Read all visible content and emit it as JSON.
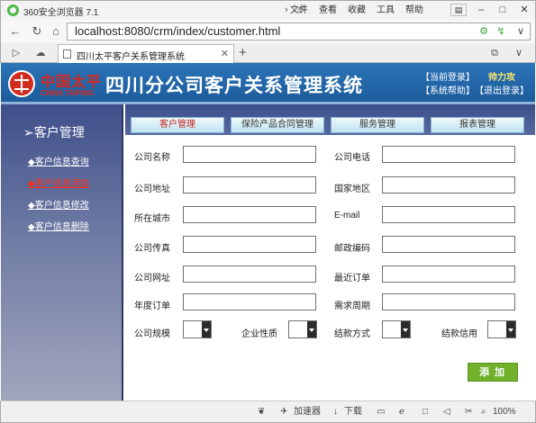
{
  "browser": {
    "app_title": "360安全浏览器 7.1",
    "menu": [
      "文件",
      "查看",
      "收藏",
      "工具",
      "帮助"
    ],
    "url": "localhost:8080/crm/index/customer.html",
    "tab_label": "四川太平客户关系管理系统",
    "icons": {
      "menu_chevron": "chevron-right-icon",
      "user": "user-icon",
      "back": "back-arrow-icon",
      "refresh": "refresh-icon",
      "home": "home-icon",
      "security": "security-icon",
      "speed": "lightning-icon",
      "dropdown": "chevron-down-icon"
    }
  },
  "header": {
    "logo_cn": "中国太平",
    "logo_en": "CHINA TAIPING",
    "title": "四川分公司客户关系管理系统",
    "current_login": "【当前登录】",
    "username": "帅力攻",
    "help": "【系统帮助】",
    "logout": "【退出登录】"
  },
  "sidebar": {
    "heading": "➢客户管理",
    "items": [
      {
        "label": "◆客户信息查询"
      },
      {
        "label": "◆客户信息添加"
      },
      {
        "label": "◆客户信息修改"
      },
      {
        "label": "◆客户信息删除"
      }
    ]
  },
  "tabs": [
    {
      "label": "客户管理"
    },
    {
      "label": "保险产品合同管理"
    },
    {
      "label": "服务管理"
    },
    {
      "label": "报表管理"
    }
  ],
  "form": {
    "company_name": "公司名称",
    "company_phone": "公司电话",
    "company_address": "公司地址",
    "country_region": "国家地区",
    "city": "所在城市",
    "email": "E-mail",
    "company_fax": "公司传真",
    "postal_code": "邮政编码",
    "company_website": "公司网址",
    "latest_order": "最近订单",
    "annual_order": "年度订单",
    "demand_cycle": "需求周期",
    "company_size": "公司规模",
    "enterprise_type": "企业性质",
    "settlement_method": "结款方式",
    "settlement_credit": "结款信用",
    "add_button": "添加"
  },
  "statusbar": {
    "accelerator": "加速器",
    "download": "下载",
    "zoom": "100%"
  },
  "colors": {
    "banner": "#1f63a8",
    "sidebar": "#5b6895",
    "active_red": "#ff2d1c",
    "add_green": "#70b02a"
  }
}
